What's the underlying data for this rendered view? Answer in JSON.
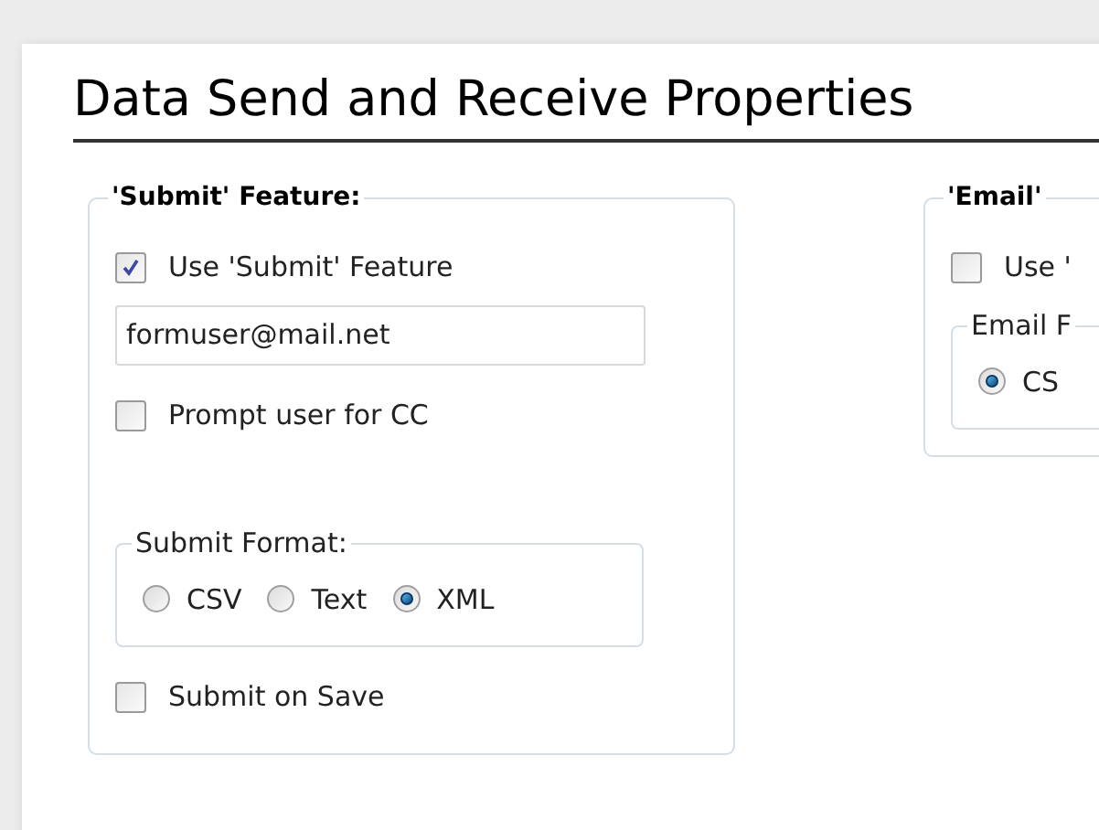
{
  "title": "Data Send and Receive Properties",
  "sections": [
    {
      "legend": "'Submit' Feature:",
      "items": [
        {
          "kind": "checkbox",
          "label": "Use 'Submit' Feature",
          "checked": true
        },
        {
          "kind": "field",
          "value": "formuser@mail.net"
        },
        {
          "kind": "checkbox",
          "label": "Prompt user for CC",
          "checked": false
        },
        {
          "kind": "group",
          "legend": "Submit Format:",
          "options": [
            {
              "label": "CSV",
              "selected": false
            },
            {
              "label": "Text",
              "selected": false
            },
            {
              "label": "XML",
              "selected": true
            }
          ]
        },
        {
          "kind": "checkbox",
          "label": "Submit on Save",
          "checked": false
        }
      ]
    },
    {
      "legend": "'Email'",
      "items": [
        {
          "kind": "checkbox",
          "label": "Use '",
          "checked": false
        },
        {
          "kind": "group",
          "legend": "Email F",
          "options": [
            {
              "label": "CS",
              "selected": true
            }
          ]
        }
      ]
    }
  ]
}
